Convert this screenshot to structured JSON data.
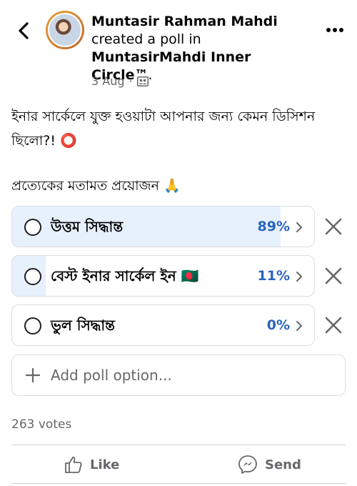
{
  "header": {
    "author": "Muntasir Rahman Mahdi",
    "action": "created a poll in",
    "group": "MuntasirMahdi Inner Circle™",
    "suffix": ".",
    "date": "3 Aug",
    "separator": "·",
    "privacy_icon": "group-icon",
    "back_icon": "chevron-left-icon",
    "more_icon": "more-dots-icon"
  },
  "post": {
    "text": "ইনার সার্কেলে যুক্ত হওয়াটা আপনার জন্য কেমন ডিসিশন ছিলো?! ⭕",
    "subtext": "প্রত্যেকের মতামত প্রয়োজন 🙏"
  },
  "poll": {
    "options": [
      {
        "label": "উত্তম সিদ্ধান্ত",
        "percent": "89%",
        "fraction": 0.89
      },
      {
        "label": "বেস্ট ইনার সার্কেল ইন 🇧🇩",
        "percent": "11%",
        "fraction": 0.11
      },
      {
        "label": "ভুল সিদ্ধান্ত",
        "percent": "0%",
        "fraction": 0.0
      }
    ],
    "add_option_placeholder": "Add poll option...",
    "votes": "263 votes"
  },
  "actions": {
    "like": "Like",
    "send": "Send"
  },
  "colors": {
    "accent": "#2a63c0",
    "fill": "#e7f0fd",
    "muted": "#65676b"
  }
}
